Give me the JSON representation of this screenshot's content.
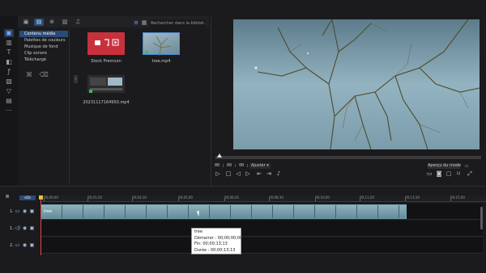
{
  "media_tabs": [
    {
      "name": "media-room-tab",
      "icon": "▣"
    },
    {
      "name": "library-tab",
      "icon": "▤"
    },
    {
      "name": "import-tab",
      "icon": "⊕"
    },
    {
      "name": "image-tab",
      "icon": "▧"
    },
    {
      "name": "music-tab",
      "icon": "♫"
    }
  ],
  "search": {
    "placeholder": "Rechercher dans la biblio..."
  },
  "categories": [
    {
      "label": "Contenu média",
      "active": true
    },
    {
      "label": "Palettes de couleurs"
    },
    {
      "label": "Musique de fond"
    },
    {
      "label": "Clip sonore"
    },
    {
      "label": "Téléchargé"
    }
  ],
  "media_items": [
    {
      "caption": "Stock Premium"
    },
    {
      "caption": "tree.mp4"
    },
    {
      "caption": "20231117164950.mp4"
    }
  ],
  "player": {
    "timecode": "00 ; 00 ; 00 ; 00",
    "fit_label": "Ajuster",
    "preview_button": "Aperçu du mode"
  },
  "timeline": {
    "zoom_label": "e1b",
    "ticks": [
      "00;00;00",
      "00;01;20",
      "00;03;10",
      "00;05;00",
      "00;06;20",
      "00;08;10",
      "00;10;00",
      "00;11;20",
      "00;13;10",
      "00;15;00"
    ],
    "tracks": [
      {
        "num": "1."
      },
      {
        "num": "1."
      },
      {
        "num": "2."
      }
    ],
    "clip_label": "tree"
  },
  "tooltip": {
    "name": "tree",
    "start": "Démarrer : 00;00;00;00",
    "end": "Fin: 00;00;13;13",
    "duration": "Durée : 00;00;13;13"
  }
}
